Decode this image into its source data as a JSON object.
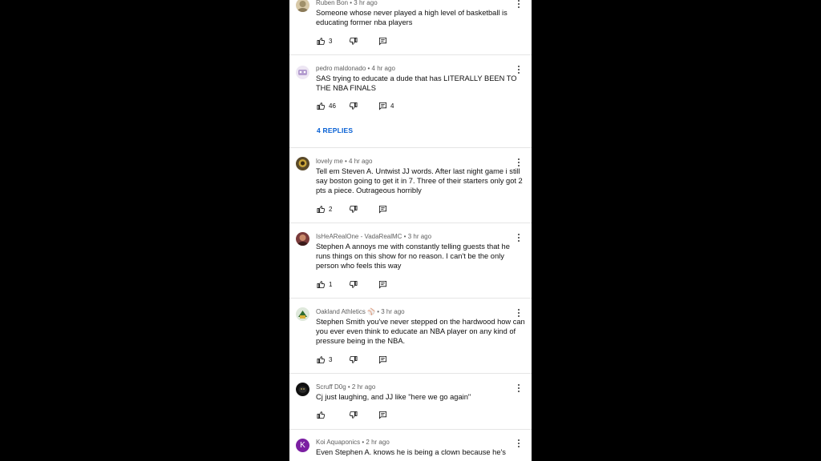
{
  "comments": [
    {
      "author": "Ruben Bon",
      "time": "3 hr ago",
      "text": "Someone whose never played a high level of basketball is educating former nba players",
      "likes": "3",
      "reply_count": "",
      "avatar_color": "#d8c9a8"
    },
    {
      "author": "pedro maldonado",
      "time": "4 hr ago",
      "text": "SAS trying to educate a dude that has LITERALLY BEEN TO THE NBA FINALS",
      "likes": "46",
      "reply_count": "4",
      "replies_link": "4 REPLIES",
      "avatar_color": "#c9b7d9"
    },
    {
      "author": "lovely me",
      "time": "4 hr ago",
      "text": "Tell em Steven A.  Untwist JJ words. After last night game i still say boston going to get it in 7. Three of their starters only got 2 pts a piece. Outrageous horribly",
      "likes": "2",
      "reply_count": "",
      "avatar_color": "#5a4a2a"
    },
    {
      "author": "IsHeARealOne - VadaRealMC",
      "time": "3 hr ago",
      "text": "Stephen A annoys me with constantly telling guests that he runs things on this show for no reason. I can't be the only person who feels this way",
      "likes": "1",
      "reply_count": "",
      "avatar_color": "#7a3b3b"
    },
    {
      "author": "Oakland Athletics ⚾",
      "time": "3 hr ago",
      "text": "Stephen Smith you've never stepped on the hardwood how can you ever even think to educate an NBA player on any kind of pressure being in the NBA.",
      "likes": "3",
      "reply_count": "",
      "avatar_color": "#7da07a"
    },
    {
      "author": "Scruff D0g",
      "time": "2 hr ago",
      "text": "Cj just laughing, and JJ like \"here we go again\"",
      "likes": "",
      "reply_count": "",
      "avatar_color": "#111111"
    },
    {
      "author": "Koi Aquaponics",
      "time": "2 hr ago",
      "text": "Even Stephen A. knows he is being a clown because he's",
      "likes": "",
      "reply_count": "",
      "avatar_letter": "K",
      "avatar_color": "#7b1fa2"
    }
  ],
  "separator": " • "
}
